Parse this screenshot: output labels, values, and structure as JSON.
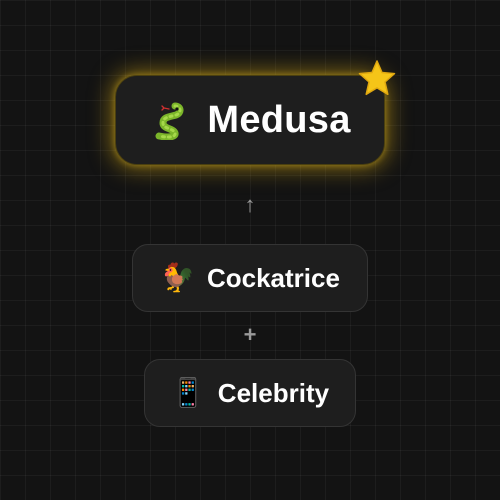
{
  "result": {
    "name": "Medusa",
    "emoji": "🐍",
    "favorite_icon": "star-icon"
  },
  "arrow_symbol": "↑",
  "plus_symbol": "+",
  "ingredients": [
    {
      "name": "Cockatrice",
      "emoji": "🐓"
    },
    {
      "name": "Celebrity",
      "emoji": "📱"
    }
  ],
  "colors": {
    "background": "#131313",
    "card": "#1e1e1e",
    "glow": "#d7aa14",
    "star": "#f5c518"
  }
}
